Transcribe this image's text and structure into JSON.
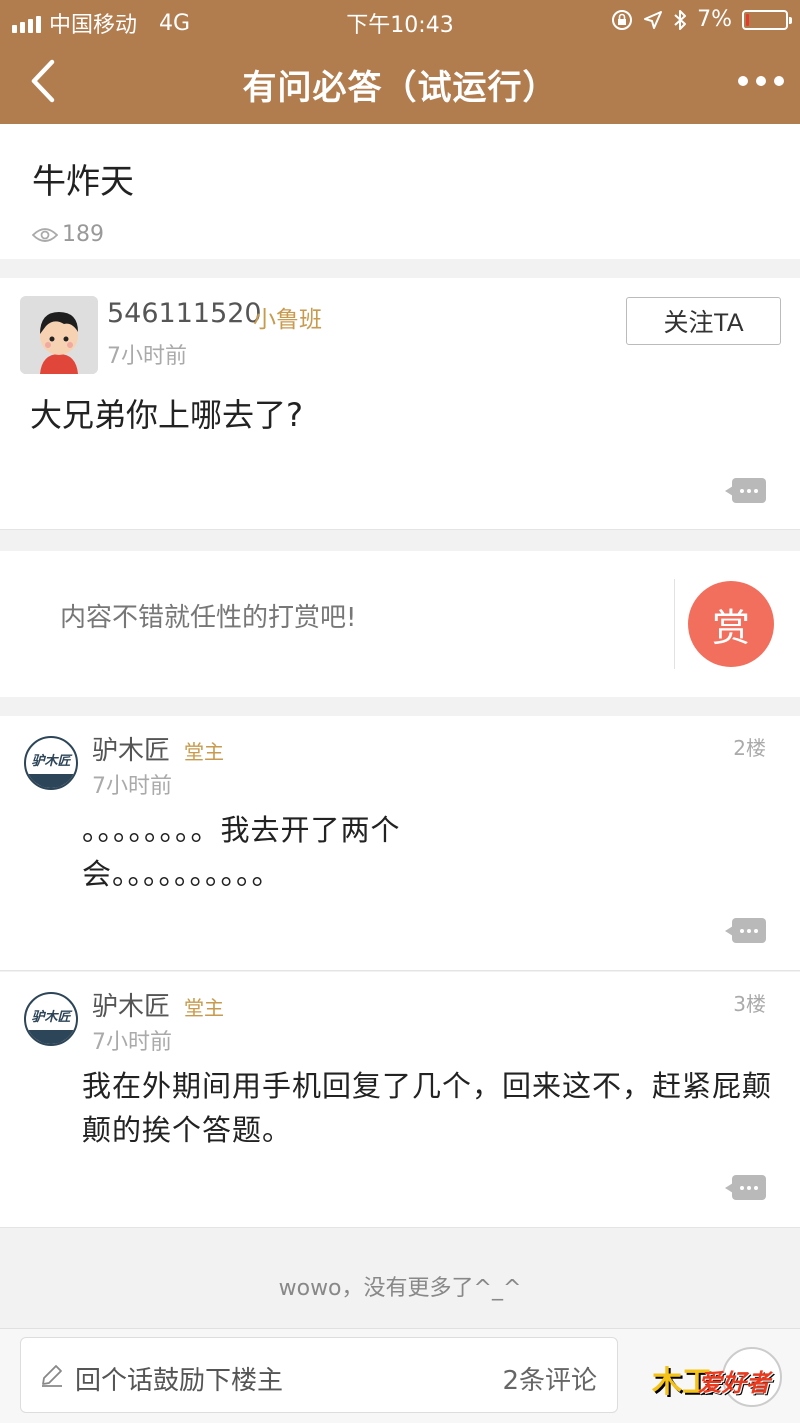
{
  "status_bar": {
    "carrier": "中国移动",
    "network": "4G",
    "time": "下午10:43",
    "battery": "7%",
    "battery_level": 0.07
  },
  "nav": {
    "title": "有问必答（试运行）",
    "back_icon": "chevron-left-icon",
    "more_icon": "more-dots-icon"
  },
  "question": {
    "title": "牛炸天",
    "views": "189"
  },
  "answer": {
    "user": "546111520",
    "badge": "小鲁班",
    "time": "7小时前",
    "follow_label": "关注TA",
    "body": "大兄弟你上哪去了?"
  },
  "reward": {
    "text": "内容不错就任性的打赏吧!",
    "button": "赏"
  },
  "comments": [
    {
      "user": "驴木匠",
      "badge": "堂主",
      "time": "7小时前",
      "floor": "2楼",
      "logo_text": "驴木匠",
      "body": "。。。。。。。。我去开了两个会。。。。。。。。。。"
    },
    {
      "user": "驴木匠",
      "badge": "堂主",
      "time": "7小时前",
      "floor": "3楼",
      "logo_text": "驴木匠",
      "body": "我在外期间用手机回复了几个，回来这不，赶紧屁颠颠的挨个答题。"
    }
  ],
  "end_text": "wowo，没有更多了^_^",
  "bottom": {
    "reply_placeholder": "回个话鼓励下楼主",
    "comment_count": "2条评论",
    "watermark_a": "木工",
    "watermark_b": "爱好者"
  },
  "colors": {
    "header": "#b17d4f",
    "badge": "#c89a4d",
    "reward_button": "#f26f5d"
  }
}
